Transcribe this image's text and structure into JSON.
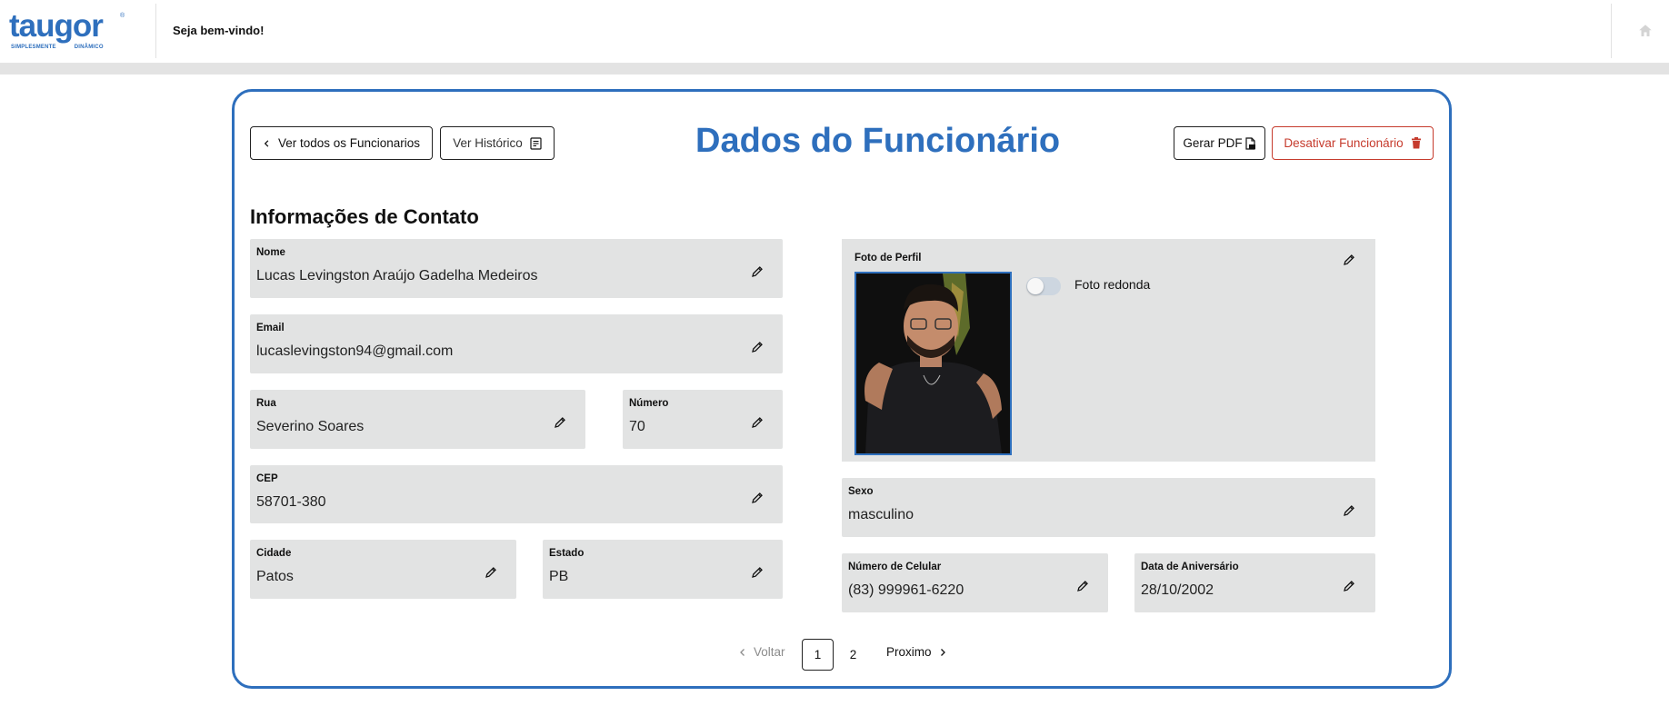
{
  "header": {
    "logo_text": "taugor",
    "logo_tagline_left": "SIMPLESMENTE",
    "logo_tagline_right": "DINÂMICO",
    "welcome": "Seja bem-vindo!",
    "home_icon": "home-icon"
  },
  "toolbar": {
    "back_label": "Ver todos os Funcionarios",
    "history_label": "Ver Histórico",
    "pdf_label": "Gerar PDF",
    "deactivate_label": "Desativar Funcionário"
  },
  "page_title": "Dados do Funcionário",
  "section_title": "Informações de Contato",
  "fields": {
    "nome": {
      "label": "Nome",
      "value": "Lucas Levingston Araújo Gadelha Medeiros"
    },
    "email": {
      "label": "Email",
      "value": "lucaslevingston94@gmail.com"
    },
    "rua": {
      "label": "Rua",
      "value": "Severino Soares"
    },
    "numero": {
      "label": "Número",
      "value": "70"
    },
    "cep": {
      "label": "CEP",
      "value": "58701-380"
    },
    "cidade": {
      "label": "Cidade",
      "value": "Patos"
    },
    "estado": {
      "label": "Estado",
      "value": "PB"
    },
    "sexo": {
      "label": "Sexo",
      "value": "masculino"
    },
    "celular": {
      "label": "Número de Celular",
      "value": "(83) 999961-6220"
    },
    "aniversario": {
      "label": "Data de Aniversário",
      "value": "28/10/2002"
    }
  },
  "profile": {
    "label": "Foto de Perfil",
    "toggle_label": "Foto redonda",
    "toggle_on": false
  },
  "pagination": {
    "prev_label": "Voltar",
    "pages": [
      "1",
      "2"
    ],
    "current": "1",
    "next_label": "Proximo"
  },
  "colors": {
    "accent": "#2e6fbd",
    "danger": "#c63b2d",
    "field_bg": "#e2e3e3"
  }
}
